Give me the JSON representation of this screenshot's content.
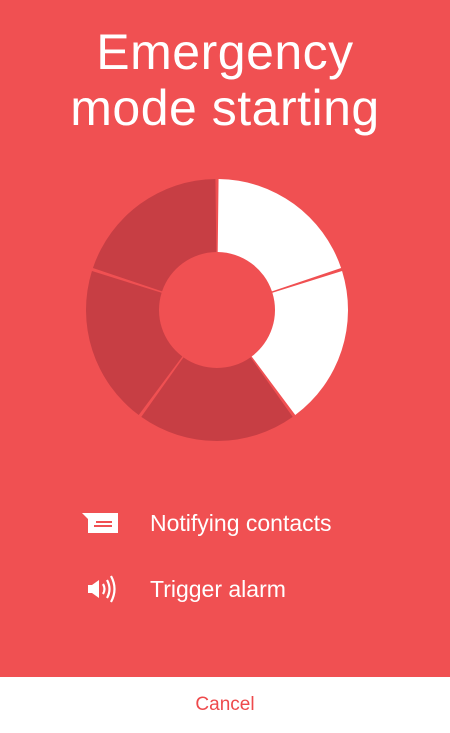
{
  "title_line1": "Emergency",
  "title_line2": "mode starting",
  "progress": {
    "total_segments": 5,
    "completed_segments": 2
  },
  "colors": {
    "background": "#F05052",
    "complete": "#FFFFFF",
    "pending": "#C73E44",
    "cancel_text": "#EE4A4C"
  },
  "steps": [
    {
      "icon": "message-icon",
      "label": "Notifying contacts"
    },
    {
      "icon": "speaker-icon",
      "label": "Trigger alarm"
    }
  ],
  "cancel_label": "Cancel"
}
